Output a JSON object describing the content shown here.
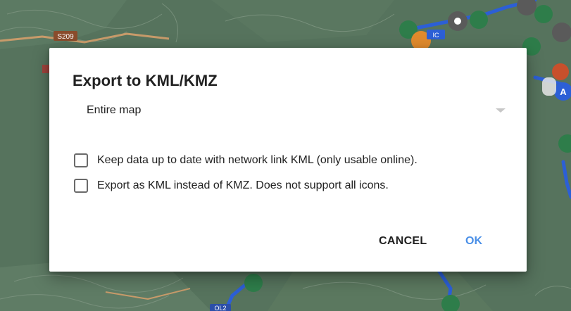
{
  "map": {
    "road_label_1": "S209",
    "road_label_2": "OL2",
    "marker_letter": "A",
    "chip_text": "IC"
  },
  "dialog": {
    "title": "Export to KML/KMZ",
    "scope_select": {
      "value": "Entire map"
    },
    "options": [
      {
        "label": "Keep data up to date with network link KML (only usable online).",
        "checked": false
      },
      {
        "label": "Export as KML instead of KMZ. Does not support all icons.",
        "checked": false
      }
    ],
    "buttons": {
      "cancel": "CANCEL",
      "ok": "OK"
    }
  },
  "colors": {
    "ok_accent": "#4a8fe7",
    "route_blue": "#2c5fd6",
    "marker_green": "#2e7d4a",
    "marker_orange": "#e08a2c",
    "marker_gray": "#5a5a5a"
  }
}
